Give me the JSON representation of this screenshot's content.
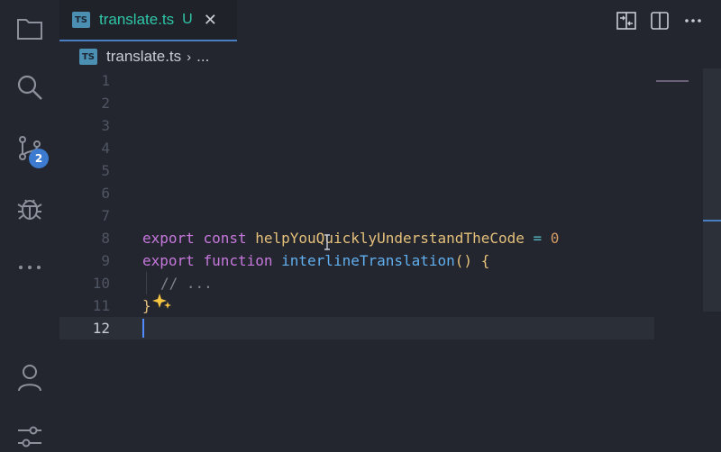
{
  "activity_bar": {
    "icons": [
      "explorer-icon",
      "search-icon",
      "source-control-icon",
      "debug-icon",
      "more-icon",
      "account-icon",
      "settings-sliders-icon"
    ],
    "source_control_badge": "2"
  },
  "tab": {
    "icon_text": "TS",
    "label": "translate.ts",
    "status": "U",
    "close": "✕"
  },
  "tab_actions": [
    "compare-icon",
    "split-editor-icon",
    "more-actions-icon"
  ],
  "breadcrumb": {
    "icon_text": "TS",
    "file": "translate.ts",
    "separator": "›",
    "more": "..."
  },
  "editor": {
    "line_numbers": [
      "1",
      "2",
      "3",
      "4",
      "5",
      "6",
      "7",
      "8",
      "9",
      "10",
      "11",
      "12"
    ],
    "active_line": "12",
    "lines": {
      "l8": {
        "kw1": "export",
        "kw2": "const",
        "name": "helpYouQuicklyUnderstandTheCode",
        "op": "=",
        "value": "0"
      },
      "l9": {
        "kw1": "export",
        "kw2": "function",
        "name": "interlineTranslation",
        "parens": "()",
        "brace": "{"
      },
      "l10": {
        "comment": "// ..."
      },
      "l11": {
        "brace": "}"
      }
    }
  },
  "colors": {
    "accent": "#4a7ec3",
    "tab_label": "#2fc6a8",
    "keyword": "#c678dd",
    "variable": "#e5c07b",
    "function": "#61afef",
    "number": "#d19a66"
  }
}
